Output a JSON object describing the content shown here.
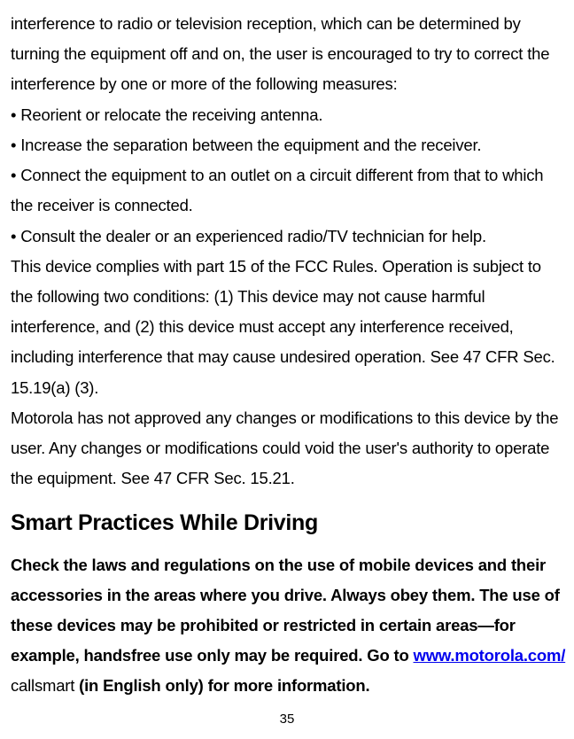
{
  "para1": "interference to radio or television reception, which can be determined by turning the equipment off and on, the user is encouraged to try to correct the interference by one or more of the following measures:",
  "bullet1": "• Reorient or relocate the receiving antenna.",
  "bullet2": "• Increase the separation between the equipment and the receiver.",
  "bullet3": "• Connect the equipment to an outlet on a circuit different from that to which the receiver is connected.",
  "bullet4": "• Consult the dealer or an experienced radio/TV technician for help.",
  "para2": "This device complies with part 15 of the FCC Rules. Operation is subject to the following two conditions: (1) This device may not cause harmful interference, and (2) this device must accept any interference received, including interference that may cause undesired operation. See 47 CFR Sec. 15.19(a) (3).",
  "para3": "Motorola has not approved any changes or modifications to this device by the user. Any changes or modifications could void the user's authority to operate the equipment. See 47 CFR Sec. 15.21.",
  "heading": "Smart Practices While Driving",
  "bold_pre": "Check the laws and regulations on the use of mobile devices and their accessories in the areas where you drive. Always obey them. The use of these devices may be prohibited or restricted in certain areas—for example, handsfree use only may be required. Go to ",
  "link": "www.motorola.com/",
  "nonbold_mid": " callsmart ",
  "bold_post": "(in English only) for more information.",
  "page_number": "35"
}
